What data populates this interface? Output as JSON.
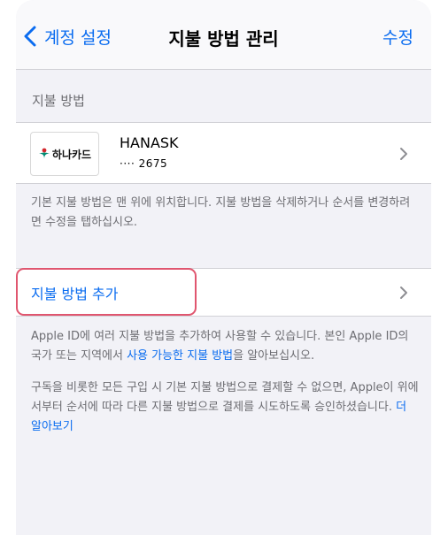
{
  "nav": {
    "back_label": "계정 설정",
    "title": "지불 방법 관리",
    "edit_label": "수정"
  },
  "section": {
    "header": "지불 방법"
  },
  "card": {
    "logo_text": "하나카드",
    "name": "HANASK",
    "number": "···· 2675"
  },
  "note1": "기본 지불 방법은 맨 위에 위치합니다. 지불 방법을 삭제하거나 순서를 변경하려면 수정을 탭하십시오.",
  "add": {
    "label": "지불 방법 추가"
  },
  "note2": {
    "text1": "Apple ID에 여러 지불 방법을 추가하여 사용할 수 있습니다. 본인 Apple ID의 국가 또는 지역에서 ",
    "link": "사용 가능한 지불 방법",
    "text2": "을 알아보십시오."
  },
  "note3": {
    "text1": "구독을 비롯한 모든 구입 시 기본 지불 방법으로 결제할 수 없으면, Apple이 위에서부터 순서에 따라 다른 지불 방법으로 결제를 시도하도록 승인하셨습니다. ",
    "link": "더 알아보기"
  },
  "colors": {
    "accent": "#0a6cf0",
    "background": "#f2f2f7",
    "highlight": "#e0566f"
  },
  "icons": [
    "chevron-left-icon",
    "chevron-right-icon",
    "hana-card-logo"
  ]
}
